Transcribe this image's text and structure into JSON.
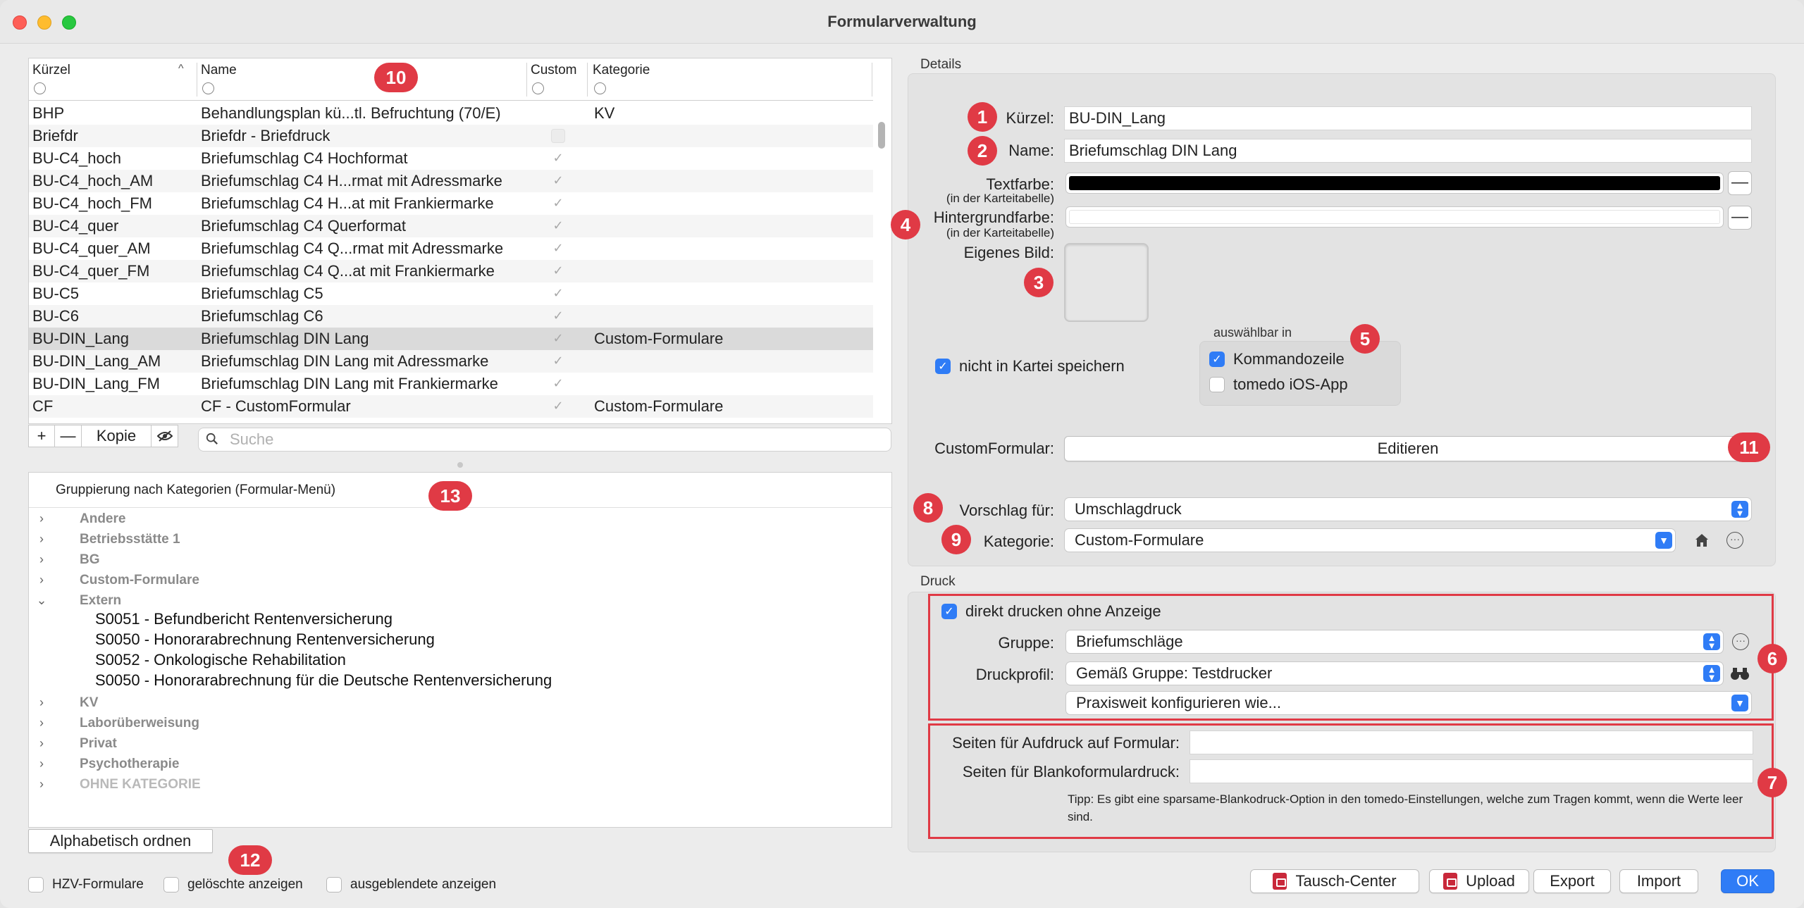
{
  "window": {
    "title": "Formularverwaltung"
  },
  "table": {
    "headers": {
      "kuerzel": "Kürzel",
      "name": "Name",
      "custom": "Custom",
      "kategorie": "Kategorie"
    },
    "rows": [
      {
        "kuerzel": "BHP",
        "name": "Behandlungsplan kü...tl. Befruchtung (70/E)",
        "custom": "",
        "kategorie": "KV"
      },
      {
        "kuerzel": "Briefdr",
        "name": "Briefdr - Briefdruck",
        "custom": "empty",
        "kategorie": ""
      },
      {
        "kuerzel": "BU-C4_hoch",
        "name": "Briefumschlag C4 Hochformat",
        "custom": "check",
        "kategorie": ""
      },
      {
        "kuerzel": "BU-C4_hoch_AM",
        "name": "Briefumschlag C4 H...rmat mit Adressmarke",
        "custom": "check",
        "kategorie": ""
      },
      {
        "kuerzel": "BU-C4_hoch_FM",
        "name": "Briefumschlag C4 H...at mit Frankiermarke",
        "custom": "check",
        "kategorie": ""
      },
      {
        "kuerzel": "BU-C4_quer",
        "name": "Briefumschlag C4 Querformat",
        "custom": "check",
        "kategorie": ""
      },
      {
        "kuerzel": "BU-C4_quer_AM",
        "name": "Briefumschlag C4 Q...rmat mit Adressmarke",
        "custom": "check",
        "kategorie": ""
      },
      {
        "kuerzel": "BU-C4_quer_FM",
        "name": "Briefumschlag C4 Q...at mit Frankiermarke",
        "custom": "check",
        "kategorie": ""
      },
      {
        "kuerzel": "BU-C5",
        "name": "Briefumschlag C5",
        "custom": "check",
        "kategorie": ""
      },
      {
        "kuerzel": "BU-C6",
        "name": "Briefumschlag C6",
        "custom": "check",
        "kategorie": ""
      },
      {
        "kuerzel": "BU-DIN_Lang",
        "name": "Briefumschlag DIN Lang",
        "custom": "check",
        "kategorie": "Custom-Formulare",
        "selected": true
      },
      {
        "kuerzel": "BU-DIN_Lang_AM",
        "name": "Briefumschlag DIN Lang mit Adressmarke",
        "custom": "check",
        "kategorie": ""
      },
      {
        "kuerzel": "BU-DIN_Lang_FM",
        "name": "Briefumschlag DIN Lang mit Frankiermarke",
        "custom": "check",
        "kategorie": ""
      },
      {
        "kuerzel": "CF",
        "name": "CF - CustomFormular",
        "custom": "check",
        "kategorie": "Custom-Formulare"
      }
    ]
  },
  "table_tools": {
    "add": "+",
    "remove": "—",
    "copy": "Kopie",
    "search_placeholder": "Suche"
  },
  "tree": {
    "header": "Gruppierung nach Kategorien (Formular-Menü)",
    "nodes": [
      {
        "label": "Andere",
        "expanded": false
      },
      {
        "label": "Betriebsstätte 1",
        "expanded": false
      },
      {
        "label": "BG",
        "expanded": false
      },
      {
        "label": "Custom-Formulare",
        "expanded": false
      },
      {
        "label": "Extern",
        "expanded": true,
        "children": [
          "S0051 - Befundbericht Rentenversicherung",
          "S0050 - Honorarabrechnung Rentenversicherung",
          "S0052 - Onkologische Rehabilitation",
          "S0050 - Honorarabrechnung für die Deutsche Rentenversicherung"
        ]
      },
      {
        "label": "KV",
        "expanded": false
      },
      {
        "label": "Laborüberweisung",
        "expanded": false
      },
      {
        "label": "Privat",
        "expanded": false
      },
      {
        "label": "Psychotherapie",
        "expanded": false
      },
      {
        "label": "OHNE KATEGORIE",
        "expanded": false,
        "dim": true
      }
    ]
  },
  "bottom_left": {
    "sort_button": "Alphabetisch ordnen",
    "hzv": "HZV-Formulare",
    "geloeschte": "gelöschte anzeigen",
    "ausgeblendete": "ausgeblendete anzeigen"
  },
  "details": {
    "section_label": "Details",
    "kuerzel_label": "Kürzel:",
    "kuerzel_value": "BU-DIN_Lang",
    "name_label": "Name:",
    "name_value": "Briefumschlag DIN Lang",
    "textfarbe_label": "Textfarbe:",
    "textfarbe_sub": "(in der Karteitabelle)",
    "textfarbe_color": "#000000",
    "hintergrund_label": "Hintergrundfarbe:",
    "hintergrund_sub": "(in der Karteitabelle)",
    "hintergrund_color": "#ffffff",
    "eigenes_bild_label": "Eigenes Bild:",
    "nicht_in_kartei": "nicht in Kartei speichern",
    "auswaehlbar_label": "auswählbar in",
    "kommandozeile": "Kommandozeile",
    "ios_app": "tomedo iOS-App",
    "customformular_label": "CustomFormular:",
    "editieren": "Editieren",
    "vorschlag_label": "Vorschlag für:",
    "vorschlag_value": "Umschlagdruck",
    "kategorie_label": "Kategorie:",
    "kategorie_value": "Custom-Formulare"
  },
  "druck": {
    "section_label": "Druck",
    "direkt_drucken": "direkt drucken ohne Anzeige",
    "gruppe_label": "Gruppe:",
    "gruppe_value": "Briefumschläge",
    "druckprofil_label": "Druckprofil:",
    "druckprofil_value": "Gemäß Gruppe: Testdrucker",
    "praxisweit": "Praxisweit konfigurieren wie...",
    "seiten_aufdruck_label": "Seiten für Aufdruck auf Formular:",
    "seiten_blanko_label": "Seiten für Blankoformulardruck:",
    "tipp": "Tipp: Es gibt eine sparsame-Blankodruck-Option in den tomedo-Einstellungen, welche zum Tragen kommt, wenn die Werte leer sind."
  },
  "footer": {
    "tausch_center": "Tausch-Center",
    "upload": "Upload",
    "export": "Export",
    "import": "Import",
    "ok": "OK"
  },
  "badges": [
    "1",
    "2",
    "3",
    "4",
    "5",
    "6",
    "7",
    "8",
    "9",
    "10",
    "11",
    "12",
    "13"
  ],
  "colors": {
    "accent": "#2f7cf6",
    "badge": "#e03a45"
  }
}
